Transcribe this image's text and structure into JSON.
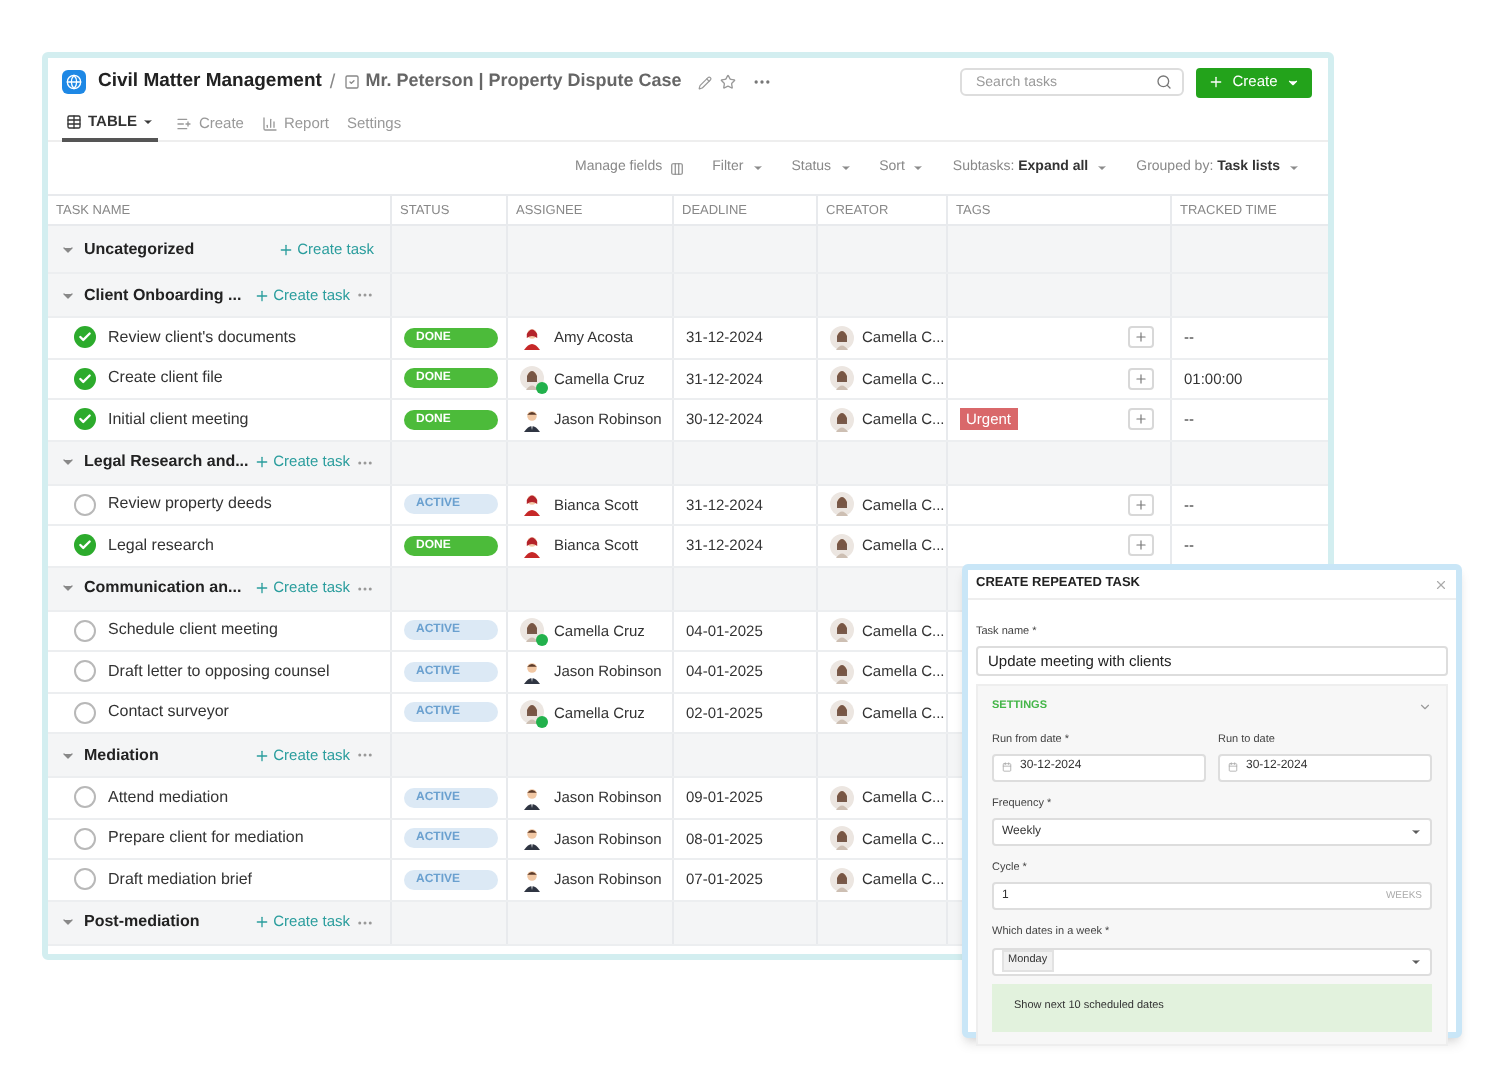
{
  "header": {
    "project": "Civil Matter Management",
    "separator": "/",
    "case": "Mr. Peterson | Property Dispute Case",
    "search": {
      "placeholder": "Search tasks"
    },
    "create_button": "Create"
  },
  "view_tabs": [
    {
      "label": "TABLE",
      "selected": true,
      "kind": "table"
    },
    {
      "label": "Create",
      "selected": false,
      "kind": "create"
    },
    {
      "label": "Report",
      "selected": false,
      "kind": "report"
    },
    {
      "label": "Settings",
      "selected": false,
      "kind": "settings"
    }
  ],
  "toolbar": [
    {
      "label": "Manage fields",
      "kind": "fields"
    },
    {
      "label": "Filter",
      "kind": "dropdown"
    },
    {
      "label": "Status",
      "kind": "dropdown"
    },
    {
      "label": "Sort",
      "kind": "dropdown"
    },
    {
      "label": "Subtasks:",
      "value": "Expand all",
      "kind": "dropdown"
    },
    {
      "label": "Grouped by:",
      "value": "Task lists",
      "kind": "dropdown"
    }
  ],
  "columns": [
    "TASK NAME",
    "STATUS",
    "ASSIGNEE",
    "DEADLINE",
    "CREATOR",
    "TAGS",
    "TRACKED TIME"
  ],
  "groups": [
    {
      "name": "Uncategorized",
      "create_label": "Create task",
      "menu": false
    },
    {
      "name": "Client Onboarding ...",
      "create_label": "Create task",
      "menu": true,
      "tasks": [
        {
          "name": "Review client's documents",
          "done": true,
          "status": {
            "label": "DONE",
            "kind": "done"
          },
          "assignee": {
            "name": "Amy Acosta",
            "kind": "red",
            "online": false
          },
          "deadline": "31-12-2024",
          "creator": "Camella C...",
          "tracked": "--"
        },
        {
          "name": "Create client file",
          "done": true,
          "status": {
            "label": "DONE",
            "kind": "done"
          },
          "assignee": {
            "name": "Camella Cruz",
            "kind": "photo",
            "online": true
          },
          "deadline": "31-12-2024",
          "creator": "Camella C...",
          "tracked": "01:00:00"
        },
        {
          "name": "Initial client meeting",
          "done": true,
          "status": {
            "label": "DONE",
            "kind": "done"
          },
          "assignee": {
            "name": "Jason Robinson",
            "kind": "suit",
            "online": false
          },
          "deadline": "30-12-2024",
          "creator": "Camella C...",
          "tag": "Urgent",
          "tracked": "--"
        }
      ]
    },
    {
      "name": "Legal Research and...",
      "create_label": "Create task",
      "menu": true,
      "tasks": [
        {
          "name": "Review property deeds",
          "done": false,
          "status": {
            "label": "ACTIVE",
            "kind": "active"
          },
          "assignee": {
            "name": "Bianca Scott",
            "kind": "red",
            "online": false
          },
          "deadline": "31-12-2024",
          "creator": "Camella C...",
          "tracked": "--"
        },
        {
          "name": "Legal research",
          "done": true,
          "status": {
            "label": "DONE",
            "kind": "done"
          },
          "assignee": {
            "name": "Bianca Scott",
            "kind": "red",
            "online": false
          },
          "deadline": "31-12-2024",
          "creator": "Camella C...",
          "tracked": "--"
        }
      ]
    },
    {
      "name": "Communication an...",
      "create_label": "Create task",
      "menu": true,
      "tasks": [
        {
          "name": "Schedule client meeting",
          "done": false,
          "status": {
            "label": "ACTIVE",
            "kind": "active"
          },
          "assignee": {
            "name": "Camella Cruz",
            "kind": "photo",
            "online": true
          },
          "deadline": "04-01-2025",
          "creator": "Camella C..."
        },
        {
          "name": "Draft letter to opposing counsel",
          "done": false,
          "status": {
            "label": "ACTIVE",
            "kind": "active"
          },
          "assignee": {
            "name": "Jason Robinson",
            "kind": "suit",
            "online": false
          },
          "deadline": "04-01-2025",
          "creator": "Camella C..."
        },
        {
          "name": "Contact surveyor",
          "done": false,
          "status": {
            "label": "ACTIVE",
            "kind": "active"
          },
          "assignee": {
            "name": "Camella Cruz",
            "kind": "photo",
            "online": true
          },
          "deadline": "02-01-2025",
          "creator": "Camella C..."
        }
      ]
    },
    {
      "name": "Mediation",
      "create_label": "Create task",
      "menu": true,
      "tasks": [
        {
          "name": "Attend mediation",
          "done": false,
          "status": {
            "label": "ACTIVE",
            "kind": "active"
          },
          "assignee": {
            "name": "Jason Robinson",
            "kind": "suit",
            "online": false
          },
          "deadline": "09-01-2025",
          "creator": "Camella C..."
        },
        {
          "name": "Prepare client for mediation",
          "done": false,
          "status": {
            "label": "ACTIVE",
            "kind": "active"
          },
          "assignee": {
            "name": "Jason Robinson",
            "kind": "suit",
            "online": false
          },
          "deadline": "08-01-2025",
          "creator": "Camella C..."
        },
        {
          "name": "Draft mediation brief",
          "done": false,
          "status": {
            "label": "ACTIVE",
            "kind": "active"
          },
          "assignee": {
            "name": "Jason Robinson",
            "kind": "suit",
            "online": false
          },
          "deadline": "07-01-2025",
          "creator": "Camella C..."
        }
      ]
    },
    {
      "name": "Post-mediation",
      "create_label": "Create task",
      "menu": true
    }
  ],
  "dialog": {
    "title": "CREATE REPEATED TASK",
    "task_name_label": "Task name *",
    "task_name": "Update meeting with clients",
    "section": "SETTINGS",
    "from_label": "Run from date *",
    "from": "30-12-2024",
    "to_label": "Run to date",
    "to": "30-12-2024",
    "frequency_label": "Frequency *",
    "frequency": "Weekly",
    "cycle_label": "Cycle *",
    "cycle": "1",
    "cycle_unit": "WEEKS",
    "days_label": "Which dates in a week *",
    "days": [
      "Monday"
    ],
    "preview": "Show next 10 scheduled dates"
  }
}
